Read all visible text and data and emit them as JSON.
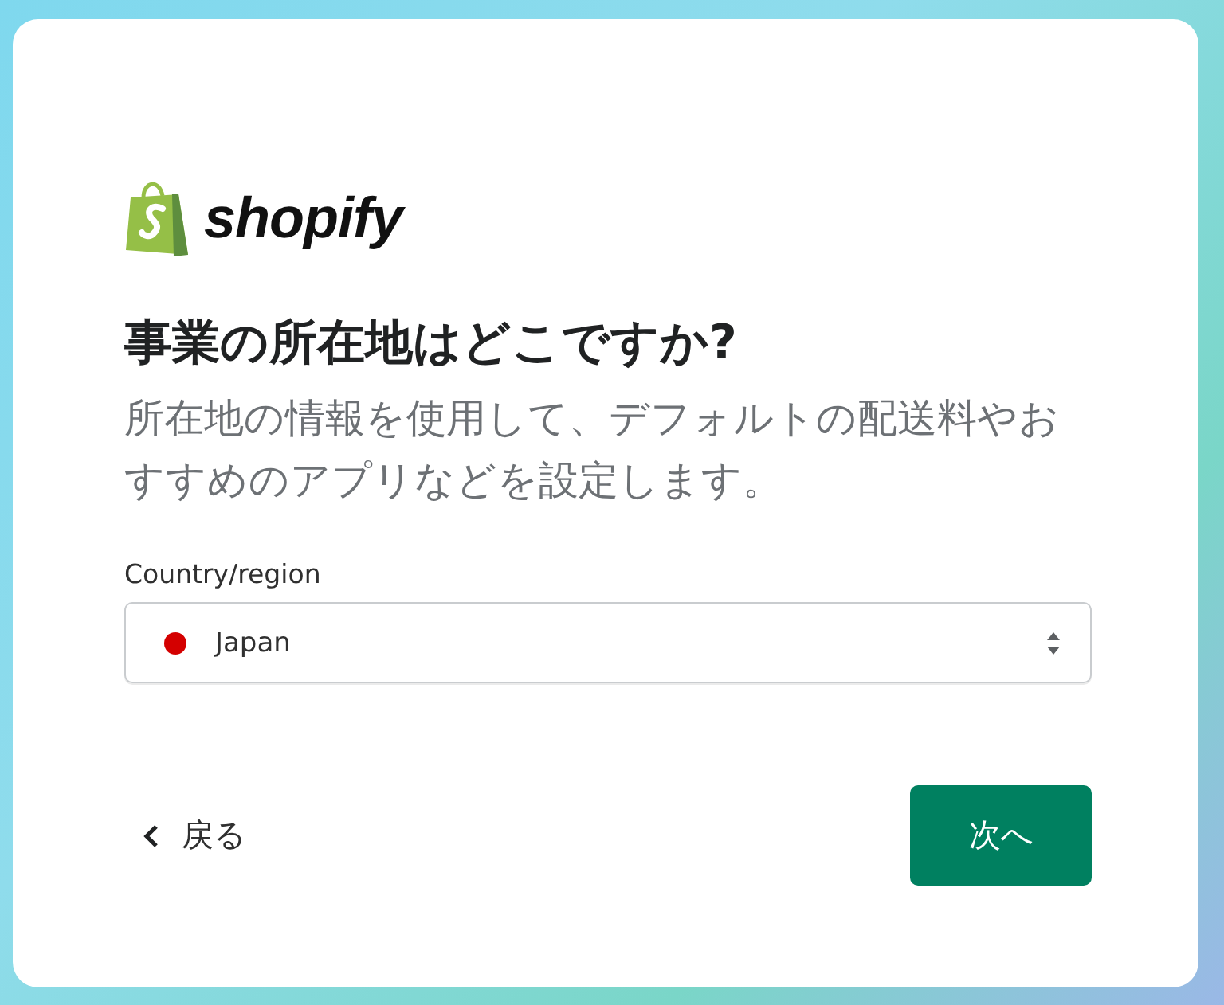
{
  "logo": {
    "wordmark": "shopify"
  },
  "title": "事業の所在地はどこですか?",
  "subtitle": "所在地の情報を使用して、デフォルトの配送料やおすすめのアプリなどを設定します。",
  "country_field": {
    "label": "Country/region",
    "value": "Japan"
  },
  "back_link": {
    "label": "戻る"
  },
  "next_button": {
    "label": "次へ"
  }
}
